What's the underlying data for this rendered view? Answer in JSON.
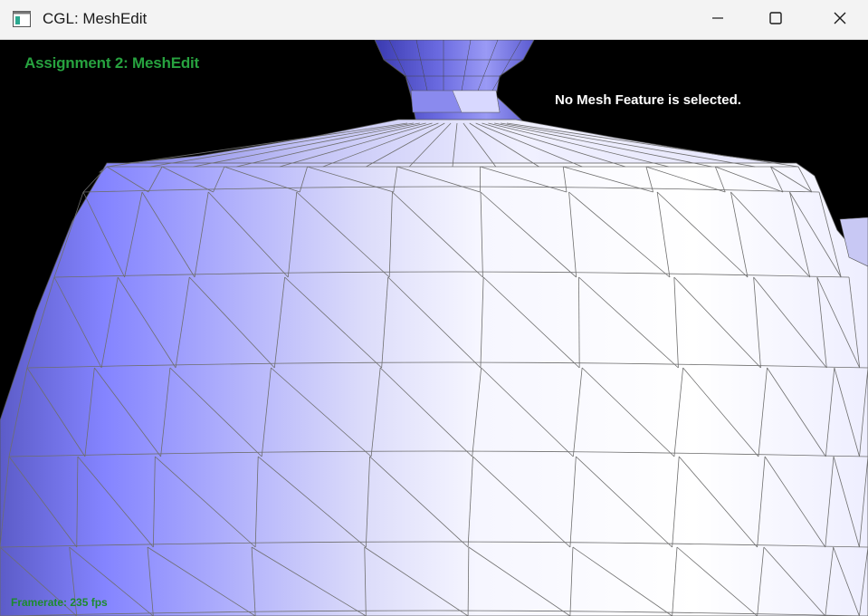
{
  "window": {
    "title": "CGL: MeshEdit",
    "app_icon": "window-app-icon",
    "controls": {
      "minimize_icon": "minimize-icon",
      "maximize_icon": "maximize-icon",
      "close_icon": "close-icon"
    }
  },
  "viewport": {
    "assignment_title": "Assignment 2: MeshEdit",
    "selection_status": "No Mesh Feature is selected.",
    "framerate": "Framerate: 235 fps",
    "colors": {
      "background": "#000000",
      "title_text": "#27a23f",
      "status_text": "#ffffff",
      "mesh_light": "#ffffff",
      "mesh_dark": "#8080ff",
      "wireframe": "#6e6e6e"
    },
    "mesh_name": "teapot"
  }
}
